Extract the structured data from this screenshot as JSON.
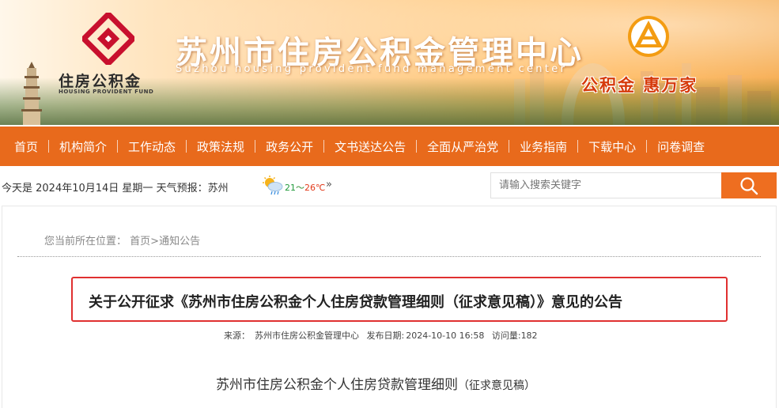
{
  "header": {
    "logo_text": "住房公积金",
    "logo_en": "HOUSING PROVIDENT FUND",
    "site_title": "苏州市住房公积金管理中心",
    "site_subtitle": "Suzhou housing provident fund management center",
    "slogan": "公积金 惠万家",
    "colors": {
      "nav": "#e86a1c",
      "logo_red": "#c8102e",
      "slogan": "#d63a0b"
    }
  },
  "nav": {
    "items": [
      {
        "label": "首页"
      },
      {
        "label": "机构简介"
      },
      {
        "label": "工作动态"
      },
      {
        "label": "政策法规"
      },
      {
        "label": "政务公开"
      },
      {
        "label": "文书送达公告"
      },
      {
        "label": "全面从严治党"
      },
      {
        "label": "业务指南"
      },
      {
        "label": "下载中心"
      },
      {
        "label": "问卷调查"
      }
    ]
  },
  "infobar": {
    "date_text": "今天是 2024年10月14日  星期一  天气预报：苏州",
    "temp_low": "21",
    "temp_sep": "～",
    "temp_high": "26℃",
    "more": "»",
    "weather_icon": "cloud-sun-rain-icon"
  },
  "search": {
    "placeholder": "请输入搜索关键字",
    "icon": "search-icon"
  },
  "breadcrumb": {
    "prefix": "您当前所在位置：",
    "home": "首页",
    "sep": ">",
    "current": "通知公告"
  },
  "article": {
    "title": "关于公开征求《苏州市住房公积金个人住房贷款管理细则（征求意见稿）》意见的公告",
    "source_label": "来源：",
    "source": "苏州市住房公积金管理中心",
    "date_label": "发布日期:",
    "date": "2024-10-10 16:58",
    "views_label": "访问量:",
    "views": "182",
    "body_heading": "苏州市住房公积金个人住房贷款管理细则",
    "body_heading_suffix": "（征求意见稿）"
  }
}
